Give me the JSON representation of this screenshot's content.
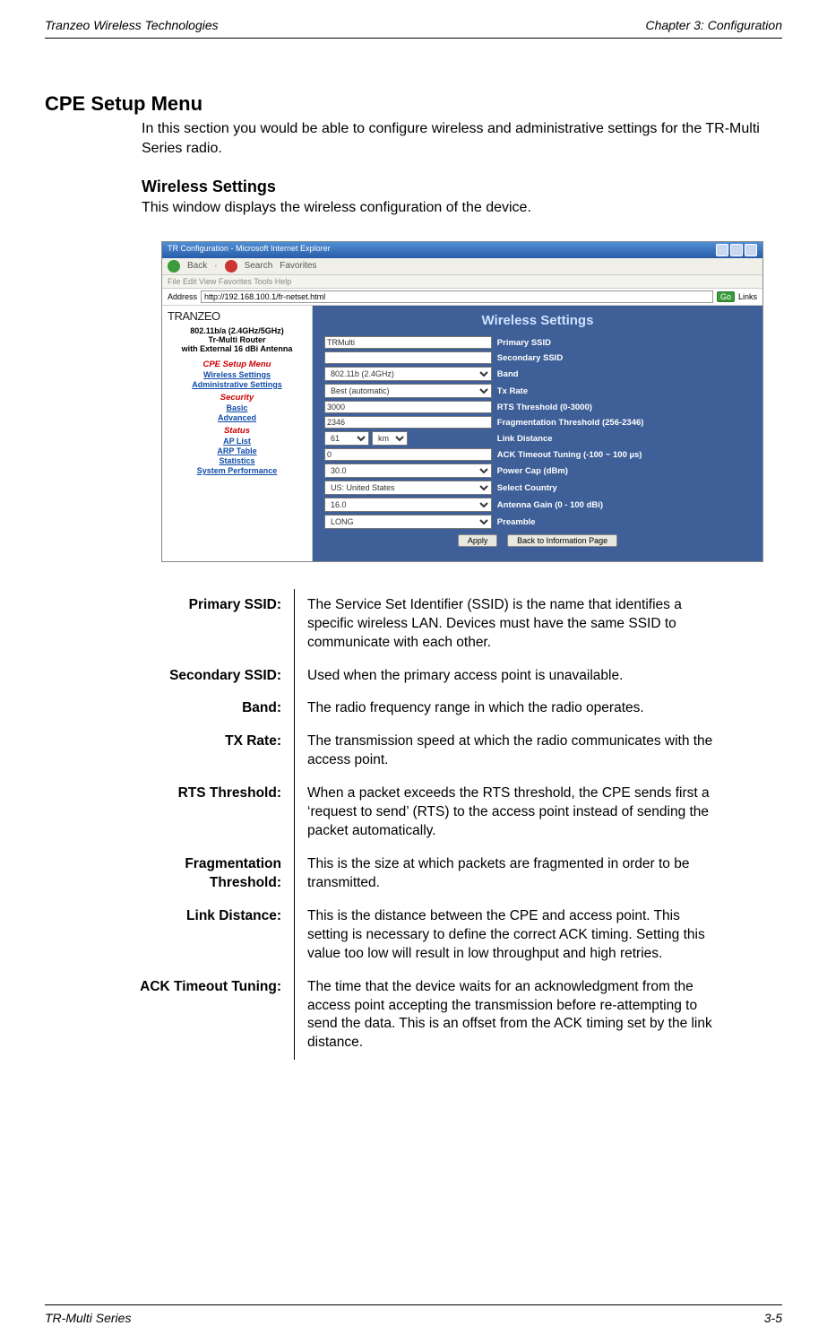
{
  "header": {
    "left": "Tranzeo Wireless Technologies",
    "right": "Chapter 3: Configuration"
  },
  "title": "CPE Setup Menu",
  "intro": "In this section you would be able to configure wireless and administrative settings for the TR-Multi Series radio.",
  "subtitle": "Wireless Settings",
  "subtext": "This window displays the wireless configuration of the device.",
  "screenshot": {
    "window_title": "TR Configuration - Microsoft Internet Explorer",
    "toolbar": {
      "back": "Back",
      "search": "Search",
      "favorites": "Favorites"
    },
    "menu": "File   Edit   View   Favorites   Tools   Help",
    "address_label": "Address",
    "address_value": "http://192.168.100.1/fr-netset.html",
    "go": "Go",
    "links": "Links",
    "side": {
      "logo": "TRANZEO",
      "model": "802.11b/a (2.4GHz/5GHz)\nTr-Multi Router\nwith External 16 dBi Antenna",
      "cpe_head": "CPE Setup Menu",
      "wireless_link": "Wireless Settings",
      "admin_link": "Administrative Settings",
      "security_head": "Security",
      "basic": "Basic",
      "advanced": "Advanced",
      "status_head": "Status",
      "ap_list": "AP List",
      "arp": "ARP Table",
      "stats": "Statistics",
      "sysperf": "System Performance"
    },
    "main": {
      "heading": "Wireless Settings",
      "rows": [
        {
          "label": "Primary SSID",
          "value": "TRMulti",
          "type": "text"
        },
        {
          "label": "Secondary SSID",
          "value": "",
          "type": "text"
        },
        {
          "label": "Band",
          "value": "802.11b (2.4GHz)",
          "type": "select"
        },
        {
          "label": "Tx Rate",
          "value": "Best (automatic)",
          "type": "select"
        },
        {
          "label": "RTS Threshold (0-3000)",
          "value": "3000",
          "type": "text"
        },
        {
          "label": "Fragmentation Threshold (256-2346)",
          "value": "2346",
          "type": "text"
        },
        {
          "label": "Link Distance",
          "value": "61",
          "unit": "km",
          "type": "num_select"
        },
        {
          "label": "ACK Timeout Tuning (-100 ~ 100 µs)",
          "value": "0",
          "type": "text"
        },
        {
          "label": "Power Cap (dBm)",
          "value": "30.0",
          "type": "select"
        },
        {
          "label": "Select Country",
          "value": "US: United States",
          "type": "select"
        },
        {
          "label": "Antenna Gain (0 - 100 dBi)",
          "value": "16.0",
          "type": "select"
        },
        {
          "label": "Preamble",
          "value": "LONG",
          "type": "select"
        }
      ],
      "apply": "Apply",
      "back": "Back to Information Page"
    }
  },
  "defs": [
    {
      "k": "Primary SSID:",
      "v": "The Service Set Identifier (SSID) is the name that identifies a specific wireless LAN. Devices must have the same SSID to communicate with each other."
    },
    {
      "k": "Secondary SSID:",
      "v": "Used when the primary access point is unavailable."
    },
    {
      "k": "Band:",
      "v": "The radio frequency range in which the radio operates."
    },
    {
      "k": "TX Rate:",
      "v": "The transmission speed at which the radio communicates with the access point."
    },
    {
      "k": "RTS Threshold:",
      "v": "When a packet exceeds the RTS threshold, the CPE sends first a ‘request to send’ (RTS) to the access point instead of sending the packet automatically."
    },
    {
      "k": "Fragmentation Threshold:",
      "v": "This is the size at which packets are fragmented in order to be transmitted."
    },
    {
      "k": "Link Distance:",
      "v": "This is the distance between the CPE and access point. This setting is necessary to define the correct ACK timing. Setting this value too low will result in low throughput and high retries."
    },
    {
      "k": "ACK Timeout Tuning:",
      "v": "The time that the device waits for an acknowledgment from the access point accepting the transmission before re-attempting to send the data. This is an offset from the ACK timing set by the link distance."
    }
  ],
  "footer": {
    "left": "TR-Multi Series",
    "right": "3-5"
  }
}
